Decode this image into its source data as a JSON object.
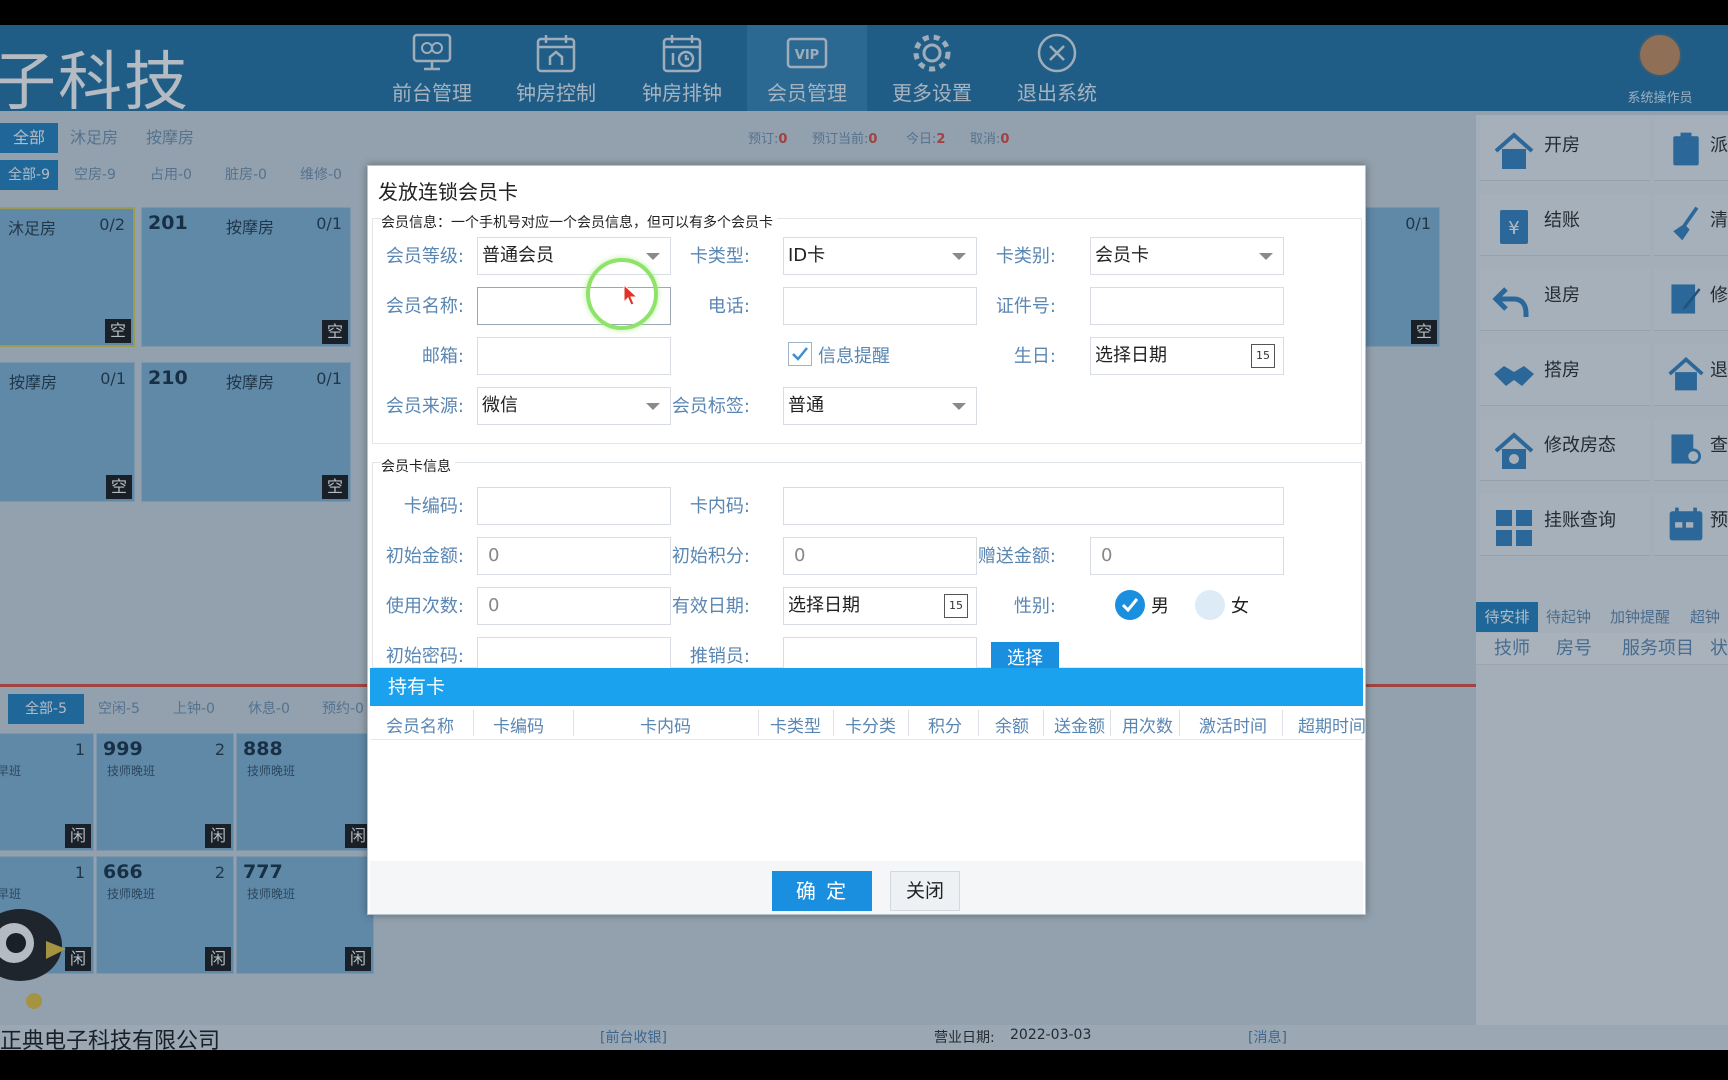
{
  "header": {
    "brand": "子科技",
    "nav": [
      {
        "label": "前台管理",
        "icon": "monitor-icon"
      },
      {
        "label": "钟房控制",
        "icon": "calendar-home-icon"
      },
      {
        "label": "钟房排钟",
        "icon": "calendar-clock-icon"
      },
      {
        "label": "会员管理",
        "icon": "vip-card-icon"
      },
      {
        "label": "更多设置",
        "icon": "gear-icon"
      },
      {
        "label": "退出系统",
        "icon": "close-circle-icon"
      }
    ],
    "user_label": "系统操作员"
  },
  "room_tabs": [
    "全部",
    "沐足房",
    "按摩房"
  ],
  "room_filters": [
    "全部-9",
    "空房-9",
    "占用-0",
    "脏房-0",
    "维修-0"
  ],
  "stats": [
    {
      "label": "预订:",
      "value": "0"
    },
    {
      "label": "预订当前:",
      "value": "0"
    },
    {
      "label": "今日:",
      "value": "2"
    },
    {
      "label": "取消:",
      "value": "0"
    }
  ],
  "rooms": [
    {
      "num": "",
      "type": "沐足房",
      "count": "0/2",
      "status": "空"
    },
    {
      "num": "201",
      "type": "按摩房",
      "count": "0/1",
      "status": "空"
    },
    {
      "num": "",
      "type": "按摩房",
      "count": "0/1",
      "status": "空"
    },
    {
      "num": "210",
      "type": "按摩房",
      "count": "0/1",
      "status": "空"
    },
    {
      "num": "",
      "type": "",
      "count": "0/1",
      "status": "空"
    }
  ],
  "tech_filters": [
    "全部-5",
    "空闲-5",
    "上钟-0",
    "休息-0",
    "预约-0"
  ],
  "techs": [
    {
      "num": "",
      "count": "1",
      "sub": "早班",
      "status": "闲"
    },
    {
      "num": "999",
      "count": "2",
      "sub": "技师晚班",
      "status": "闲"
    },
    {
      "num": "888",
      "count": "",
      "sub": "技师晚班",
      "status": "闲"
    },
    {
      "num": "",
      "count": "1",
      "sub": "早班",
      "status": "闲"
    },
    {
      "num": "666",
      "count": "2",
      "sub": "技师晚班",
      "status": "闲"
    },
    {
      "num": "777",
      "count": "",
      "sub": "技师晚班",
      "status": "闲"
    }
  ],
  "right_actions": [
    {
      "label": "开房",
      "icon": "house-icon"
    },
    {
      "label": "结账",
      "icon": "bill-icon"
    },
    {
      "label": "退房",
      "icon": "undo-icon"
    },
    {
      "label": "搭房",
      "icon": "handshake-icon"
    },
    {
      "label": "修改房态",
      "icon": "house-gear-icon"
    },
    {
      "label": "挂账查询",
      "icon": "grid-icon"
    }
  ],
  "right_actions_2": [
    {
      "label": "派",
      "icon": "clipboard-icon"
    },
    {
      "label": "清",
      "icon": "broom-icon"
    },
    {
      "label": "修",
      "icon": "edit-icon"
    },
    {
      "label": "退",
      "icon": "house-icon"
    },
    {
      "label": "查",
      "icon": "search-doc-icon"
    },
    {
      "label": "预",
      "icon": "calendar-icon"
    }
  ],
  "right_tabs": [
    "待安排",
    "待起钟",
    "加钟提醒",
    "超钟"
  ],
  "right_cols": [
    "技师",
    "房号",
    "服务项目",
    "状"
  ],
  "status_bar": {
    "company": "正典电子科技有限公司",
    "cashier": "[前台收银]",
    "biz_date_label": "营业日期:",
    "biz_date": "2022-03-03",
    "msg": "[消息]"
  },
  "dialog": {
    "title": "发放连锁会员卡",
    "section1": "会员信息：一个手机号对应一个会员信息，但可以有多个会员卡",
    "level_label": "会员等级:",
    "level_value": "普通会员",
    "cardtype_label": "卡类型:",
    "cardtype_value": "ID卡",
    "cardcat_label": "卡类别:",
    "cardcat_value": "会员卡",
    "name_label": "会员名称:",
    "name_value": "",
    "phone_label": "电话:",
    "phone_value": "",
    "id_label": "证件号:",
    "id_value": "",
    "email_label": "邮箱:",
    "email_value": "",
    "remind_label": "信息提醒",
    "remind_checked": true,
    "birthday_label": "生日:",
    "birthday_value": "选择日期",
    "source_label": "会员来源:",
    "source_value": "微信",
    "tag_label": "会员标签:",
    "tag_value": "普通",
    "section2": "会员卡信息",
    "cardno_label": "卡编码:",
    "cardno_value": "",
    "innercode_label": "卡内码:",
    "innercode_value": "",
    "initamount_label": "初始金额:",
    "initamount_value": "0",
    "initpoints_label": "初始积分:",
    "initpoints_value": "0",
    "gift_label": "赠送金额:",
    "gift_value": "0",
    "uses_label": "使用次数:",
    "uses_value": "0",
    "valid_label": "有效日期:",
    "valid_value": "选择日期",
    "gender_label": "性别:",
    "male": "男",
    "female": "女",
    "pwd_label": "初始密码:",
    "pwd_value": "",
    "seller_label": "推销员:",
    "seller_value": "",
    "select_btn": "选择",
    "held_title": "持有卡",
    "held_cols": [
      "会员名称",
      "卡编码",
      "卡内码",
      "卡类型",
      "卡分类",
      "积分",
      "余额",
      "送金额",
      "用次数",
      "激活时间",
      "超期时间"
    ],
    "ok": "确 定",
    "close": "关闭"
  },
  "calendar_day": "15",
  "colors": {
    "header": "#1d6fa3",
    "accent": "#1a8fe0",
    "room": "#7fb2d6",
    "label": "#5a86b2",
    "stat_value": "#e0453a"
  }
}
